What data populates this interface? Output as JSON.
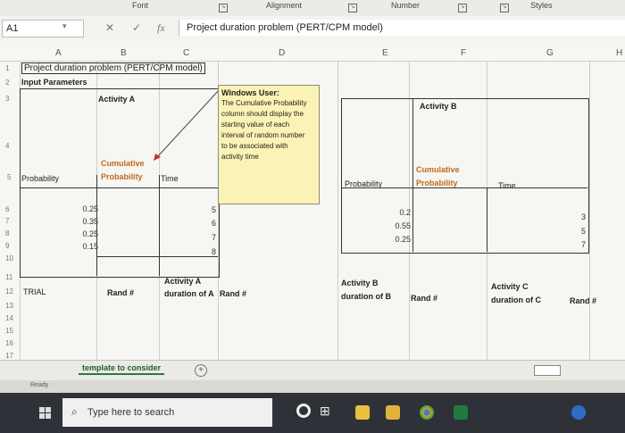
{
  "ribbon": {
    "group_labels": [
      "Font",
      "Alignment",
      "Number",
      "Styles"
    ]
  },
  "formula_bar": {
    "name_box": "A1",
    "cancel_symbol": "✕",
    "enter_symbol": "✓",
    "fx_symbol": "fx",
    "content": "Project duration problem (PERT/CPM model)"
  },
  "columns": [
    "A",
    "B",
    "C",
    "D",
    "E",
    "F",
    "G",
    "H"
  ],
  "rows": [
    "1",
    "2",
    "3",
    "4",
    "5",
    "6",
    "7",
    "8",
    "9",
    "10",
    "11",
    "12",
    "13",
    "14",
    "15",
    "16",
    "17"
  ],
  "cells": {
    "title": "Project duration problem (PERT/CPM model)",
    "input_parameters": "Input Parameters",
    "activity_a": "Activity A",
    "activity_b": "Activity B",
    "probability_a": "Probability",
    "cumulative_a": "Cumulative",
    "cumulative_a2": "Probability",
    "time_a": "Time",
    "probability_b": "Probability",
    "cumulative_b": "Cumulative",
    "cumulative_b2": "Probability",
    "time_b": "Time",
    "trial": "TRIAL",
    "rand_1": "Rand #",
    "activity_a_duration_1": "Activity A",
    "activity_a_duration_2": "duration of A",
    "rand_2": "Rand #",
    "activity_b_duration_1": "Activity B",
    "activity_b_duration_2": "duration of B",
    "rand_3": "Rand #",
    "activity_c_duration_1": "Activity C",
    "activity_c_duration_2": "duration of C",
    "rand_4": "Rand #"
  },
  "activity_a_table": {
    "probabilities": [
      "0.25",
      "0.35",
      "0.25",
      "0.15"
    ],
    "times": [
      "5",
      "6",
      "7",
      "8"
    ]
  },
  "activity_b_table": {
    "probabilities": [
      "0.2",
      "0.55",
      "0.25"
    ],
    "times": [
      "3",
      "5",
      "7"
    ]
  },
  "comment": {
    "title": "Windows User:",
    "lines": [
      "The Cumulative Probability",
      "column should display the",
      "starting value of each",
      "interval of random number",
      "to be associated with",
      "activity time"
    ]
  },
  "sheet_tab": "template to consider",
  "add_sheet": "+",
  "status": "Ready",
  "taskbar": {
    "search_placeholder": "Type here to search"
  },
  "colors": {
    "accent_green": "#2b7a3a",
    "comment_bg": "#fbf3b5",
    "orange_text": "#c26a1c"
  }
}
